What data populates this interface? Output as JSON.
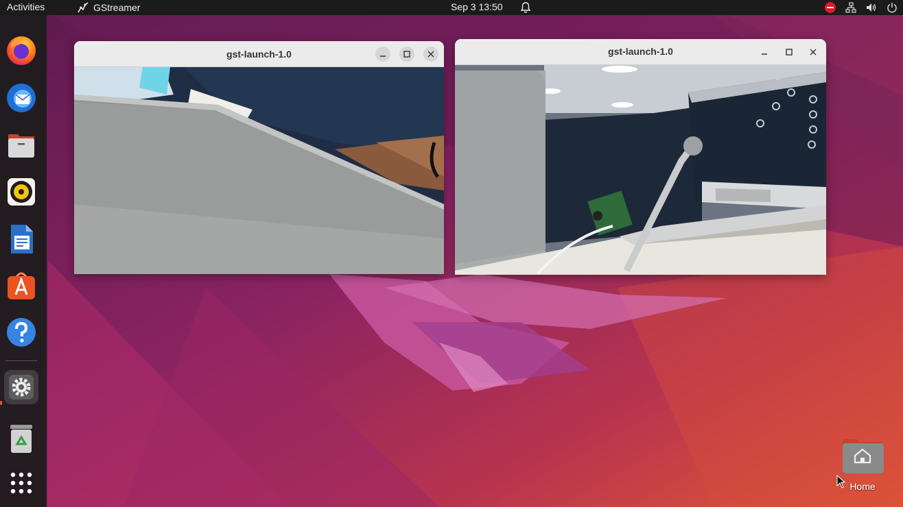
{
  "topbar": {
    "activities": "Activities",
    "app_name": "GStreamer",
    "clock": "Sep 3  13:50"
  },
  "dock": {
    "items": [
      {
        "name": "firefox-icon"
      },
      {
        "name": "thunderbird-icon"
      },
      {
        "name": "files-icon"
      },
      {
        "name": "rhythmbox-icon"
      },
      {
        "name": "libreoffice-writer-icon"
      },
      {
        "name": "app-center-icon"
      },
      {
        "name": "help-icon"
      },
      {
        "name": "settings-icon"
      },
      {
        "name": "trash-icon"
      },
      {
        "name": "show-apps-icon"
      }
    ]
  },
  "windows": [
    {
      "title": "gst-launch-1.0"
    },
    {
      "title": "gst-launch-1.0"
    }
  ],
  "desktop": {
    "home_label": "Home"
  },
  "colors": {
    "accent": "#e95420",
    "topbar": "#1b1b1b",
    "wallpaper_dark": "#6e1a56",
    "wallpaper_light": "#e0583a"
  }
}
